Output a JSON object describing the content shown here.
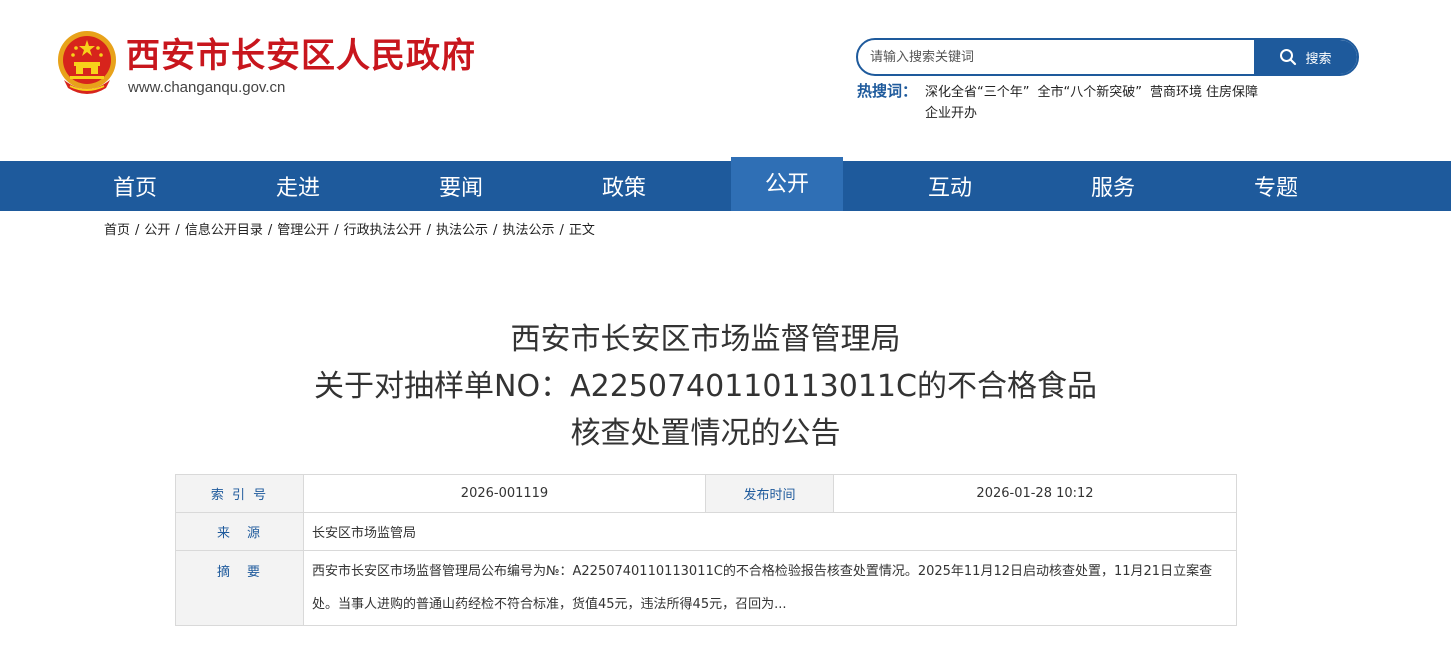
{
  "header": {
    "site_title": "西安市长安区人民政府",
    "site_url": "www.changanqu.gov.cn",
    "emblem_icon": "national-emblem-icon",
    "brand_color": "#c8161d",
    "accent_color": "#1e5a9c"
  },
  "search": {
    "placeholder": "请输入搜索关键词",
    "button_label": "搜索",
    "hot_label": "热搜词：",
    "hot_terms": [
      "深化全省“三个年”",
      "全市“八个新突破”",
      "营商环境",
      "住房保障",
      "企业开办"
    ]
  },
  "nav": {
    "items": [
      "首页",
      "走进",
      "要闻",
      "政策",
      "公开",
      "互动",
      "服务",
      "专题"
    ],
    "active": "公开"
  },
  "breadcrumb": [
    "首页",
    "公开",
    "信息公开目录",
    "管理公开",
    "行政执法公开",
    "执法公示",
    "执法公示",
    "正文"
  ],
  "article": {
    "title_lines": [
      "西安市长安区市场监督管理局",
      "关于对抽样单NO：A2250740110113011C的不合格食品",
      "核查处置情况的公告"
    ]
  },
  "info": {
    "index_label": "索 引 号",
    "index_value": "2026-001119",
    "date_label": "发布时间",
    "date_value": "2026-01-28 10:12",
    "source_label": "来　源",
    "source_value": "长安区市场监管局",
    "abstract_label": "摘　要",
    "abstract_value": "西安市长安区市场监督管理局公布编号为№：A2250740110113011C的不合格检验报告核查处置情况。2025年11月12日启动核查处置，11月21日立案查处。当事人进购的普通山药经检不符合标准，货值45元，违法所得45元，召回为..."
  }
}
